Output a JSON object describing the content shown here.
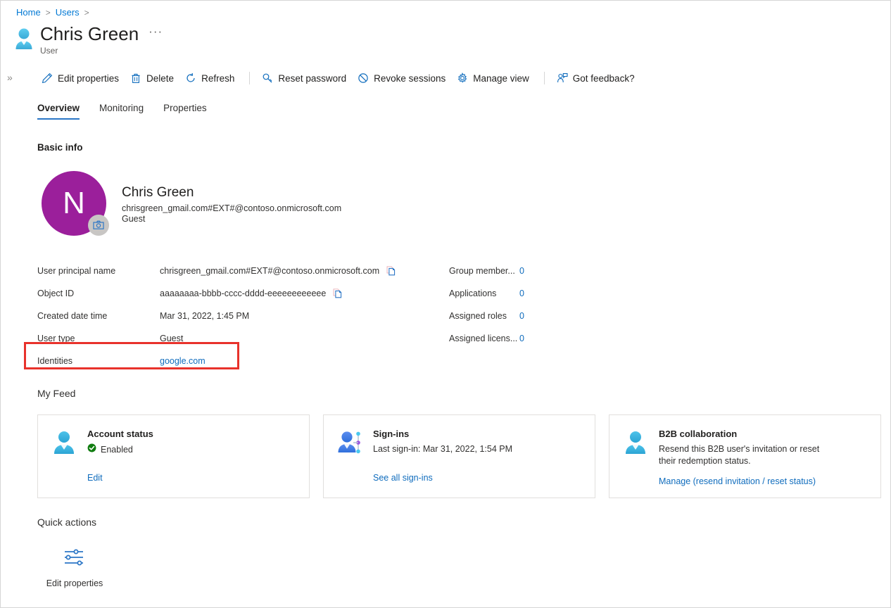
{
  "breadcrumb": {
    "items": [
      {
        "label": "Home",
        "sep": ">"
      },
      {
        "label": "Users",
        "sep": ">"
      }
    ]
  },
  "header": {
    "title": "Chris Green",
    "subtitle": "User",
    "more_label": "···",
    "person_icon": "person-icon"
  },
  "toolbar": {
    "expander": "»",
    "items": [
      {
        "label": "Edit properties",
        "icon": "pencil-icon"
      },
      {
        "label": "Delete",
        "icon": "trash-icon"
      },
      {
        "label": "Refresh",
        "icon": "refresh-icon"
      },
      {
        "label": "Reset password",
        "icon": "key-icon"
      },
      {
        "label": "Revoke sessions",
        "icon": "block-icon"
      },
      {
        "label": "Manage view",
        "icon": "gear-icon"
      },
      {
        "label": "Got feedback?",
        "icon": "feedback-icon"
      }
    ]
  },
  "tabs": [
    {
      "label": "Overview",
      "active": true
    },
    {
      "label": "Monitoring",
      "active": false
    },
    {
      "label": "Properties",
      "active": false
    }
  ],
  "sections": {
    "basic_info": "Basic info",
    "my_feed": "My Feed",
    "quick_actions": "Quick actions"
  },
  "identity": {
    "avatar_initial": "N",
    "avatar_color": "#9b1f9b",
    "camera_badge": "camera-icon",
    "name": "Chris Green",
    "upn": "chrisgreen_gmail.com#EXT#@contoso.onmicrosoft.com",
    "user_type": "Guest"
  },
  "properties_left": [
    {
      "label": "User principal name",
      "value": "chrisgreen_gmail.com#EXT#@contoso.onmicrosoft.com",
      "copy": true,
      "link": false
    },
    {
      "label": "Object ID",
      "value": "aaaaaaaa-bbbb-cccc-dddd-eeeeeeeeeeee",
      "copy": true,
      "link": false
    },
    {
      "label": "Created date time",
      "value": "Mar 31, 2022, 1:45 PM",
      "copy": false,
      "link": false
    },
    {
      "label": "User type",
      "value": "Guest",
      "copy": false,
      "link": false
    },
    {
      "label": "Identities",
      "value": "google.com",
      "copy": false,
      "link": true
    }
  ],
  "properties_right": [
    {
      "label": "Group member...",
      "value": "0"
    },
    {
      "label": "Applications",
      "value": "0"
    },
    {
      "label": "Assigned roles",
      "value": "0"
    },
    {
      "label": "Assigned licens...",
      "value": "0"
    }
  ],
  "highlight": {
    "color": "#e8322b",
    "target": "Identities"
  },
  "feed_cards": [
    {
      "icon": "person-status-icon",
      "title": "Account status",
      "status_text": "Enabled",
      "status_icon": "check-circle-icon",
      "status_color": "#107c10",
      "link": "Edit"
    },
    {
      "icon": "person-signin-icon",
      "title": "Sign-ins",
      "subtitle": "Last sign-in: Mar 31, 2022, 1:54 PM",
      "link": "See all sign-ins"
    },
    {
      "icon": "person-b2b-icon",
      "title": "B2B collaboration",
      "subtitle": "Resend this B2B user's invitation or reset their redemption status.",
      "link": "Manage (resend invitation / reset status)"
    }
  ],
  "quick_actions": [
    {
      "icon": "sliders-icon",
      "label": "Edit properties"
    }
  ],
  "colors": {
    "accent": "#0078d4",
    "link": "#0f6cbd",
    "tab_underline": "#2b76c6",
    "avatar": "#9b1f9b",
    "success": "#107c10",
    "highlight": "#e8322b"
  }
}
